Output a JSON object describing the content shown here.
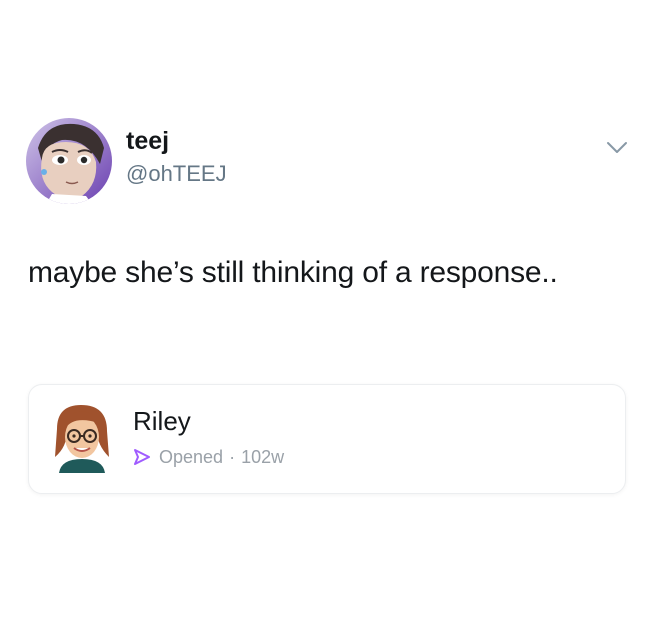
{
  "tweet": {
    "author": {
      "display_name": "teej",
      "handle": "@ohTEEJ"
    },
    "text": "maybe she’s still thinking of a response..",
    "menu_icon": "chevron-down-icon"
  },
  "snap_card": {
    "contact_name": "Riley",
    "status_label": "Opened",
    "separator": "·",
    "time_ago": "102w",
    "status_icon": "opened-arrow-icon",
    "status_color": "#a05cff"
  },
  "colors": {
    "text_primary": "#14171a",
    "text_secondary": "#657786",
    "card_border": "#eceef0",
    "opened_purple": "#a05cff"
  }
}
